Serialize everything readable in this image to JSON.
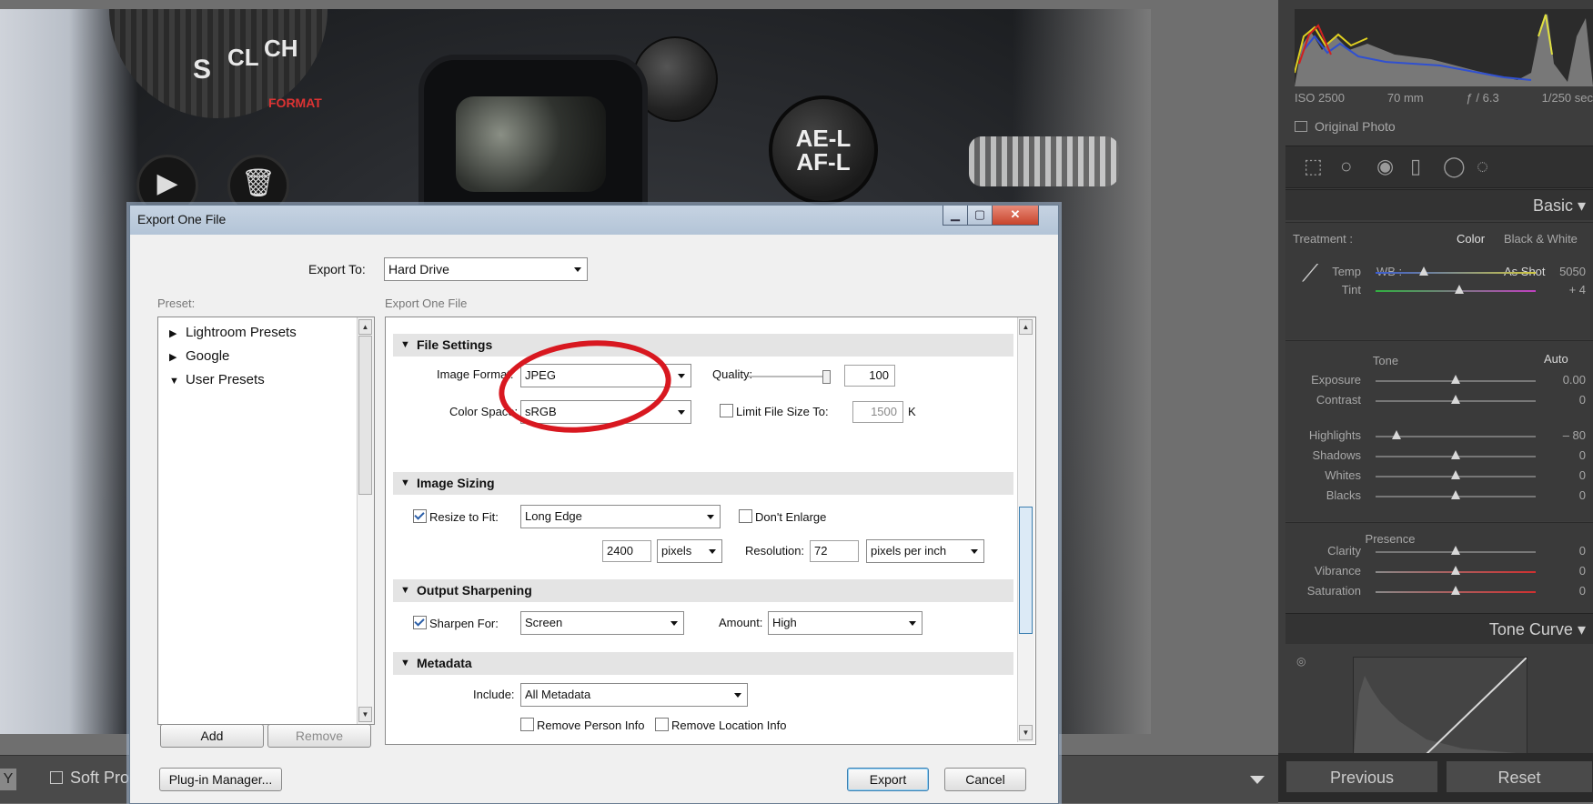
{
  "photo": {
    "dial_labels": [
      "S",
      "CL",
      "CH"
    ],
    "format_label": "FORMAT",
    "ael_label_1": "AE-L",
    "ael_label_2": "AF-L"
  },
  "bottom_bar": {
    "y_label": "Y",
    "soft_proofing_label": "Soft Proo"
  },
  "right_panel": {
    "histogram_meta": [
      "ISO 2500",
      "70 mm",
      "ƒ / 6.3",
      "1/250 sec"
    ],
    "original_photo_label": "Original Photo",
    "basic_title": "Basic",
    "treatment": {
      "label": "Treatment :",
      "color": "Color",
      "bw": "Black & White"
    },
    "wb": {
      "label": "WB :",
      "value": "As Shot"
    },
    "sliders_wb": [
      {
        "label": "Temp",
        "value": "5050",
        "pos": 0.3
      },
      {
        "label": "Tint",
        "value": "+ 4",
        "pos": 0.52
      }
    ],
    "tone_title": "Tone",
    "auto_label": "Auto",
    "sliders_tone": [
      {
        "label": "Exposure",
        "value": "0.00",
        "pos": 0.5
      },
      {
        "label": "Contrast",
        "value": "0",
        "pos": 0.5
      }
    ],
    "sliders_hl": [
      {
        "label": "Highlights",
        "value": "– 80",
        "pos": 0.13
      },
      {
        "label": "Shadows",
        "value": "0",
        "pos": 0.5
      },
      {
        "label": "Whites",
        "value": "0",
        "pos": 0.5
      },
      {
        "label": "Blacks",
        "value": "0",
        "pos": 0.5
      }
    ],
    "presence_title": "Presence",
    "sliders_presence": [
      {
        "label": "Clarity",
        "value": "0",
        "pos": 0.5
      },
      {
        "label": "Vibrance",
        "value": "0",
        "pos": 0.5
      },
      {
        "label": "Saturation",
        "value": "0",
        "pos": 0.5
      }
    ],
    "tone_curve_title": "Tone Curve",
    "previous_label": "Previous",
    "reset_label": "Reset"
  },
  "dialog": {
    "title": "Export One File",
    "export_to_label": "Export To:",
    "export_to_value": "Hard Drive",
    "preset_label": "Preset:",
    "export_one_file_label": "Export One File",
    "presets": [
      "Lightroom Presets",
      "Google",
      "User Presets"
    ],
    "add_label": "Add",
    "remove_label": "Remove",
    "file_settings": {
      "title": "File Settings",
      "image_format_label": "Image Format:",
      "image_format_value": "JPEG",
      "quality_label": "Quality:",
      "quality_value": "100",
      "color_space_label": "Color Space:",
      "color_space_value": "sRGB",
      "limit_label": "Limit File Size To:",
      "limit_value": "1500",
      "limit_unit": "K"
    },
    "image_sizing": {
      "title": "Image Sizing",
      "resize_label": "Resize to Fit:",
      "resize_value": "Long Edge",
      "dont_enlarge_label": "Don't Enlarge",
      "size_value": "2400",
      "size_unit": "pixels",
      "resolution_label": "Resolution:",
      "resolution_value": "72",
      "resolution_unit": "pixels per inch"
    },
    "output_sharpening": {
      "title": "Output Sharpening",
      "sharpen_label": "Sharpen For:",
      "sharpen_value": "Screen",
      "amount_label": "Amount:",
      "amount_value": "High"
    },
    "metadata": {
      "title": "Metadata",
      "include_label": "Include:",
      "include_value": "All Metadata",
      "remove_person_label": "Remove Person Info",
      "remove_location_label": "Remove Location Info"
    },
    "plugin_manager_label": "Plug-in Manager...",
    "export_label": "Export",
    "cancel_label": "Cancel"
  }
}
